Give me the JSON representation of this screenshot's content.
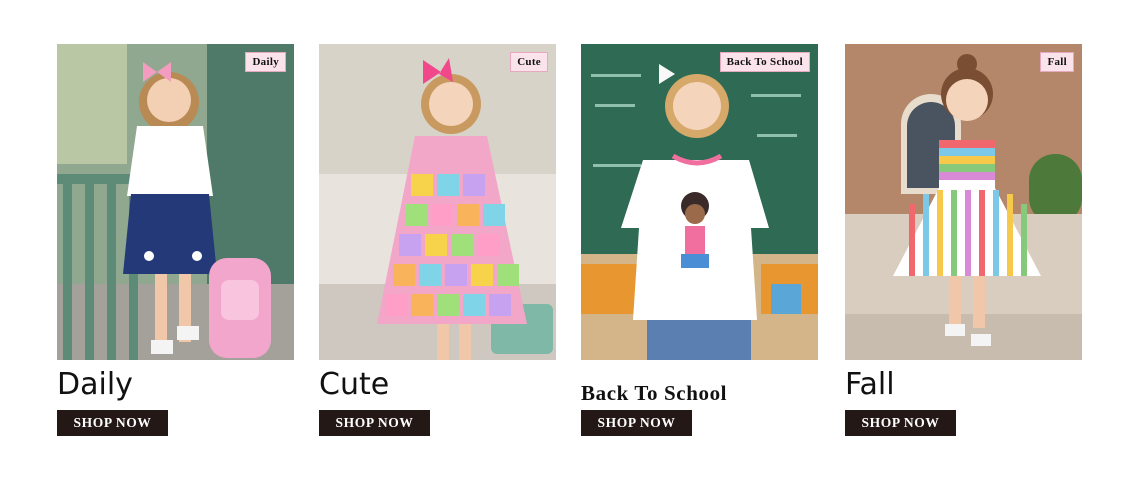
{
  "categories": [
    {
      "title": "Daily",
      "badge": "Daily",
      "button": "SHOP NOW"
    },
    {
      "title": "Cute",
      "badge": "Cute",
      "button": "SHOP NOW"
    },
    {
      "title": "Back To School",
      "badge": "Back To School",
      "button": "SHOP NOW"
    },
    {
      "title": "Fall",
      "badge": "Fall",
      "button": "SHOP NOW"
    }
  ],
  "colors": {
    "button_bg": "#231815",
    "badge_bg": "#fbe3ec",
    "badge_border": "#e7a9bf"
  }
}
